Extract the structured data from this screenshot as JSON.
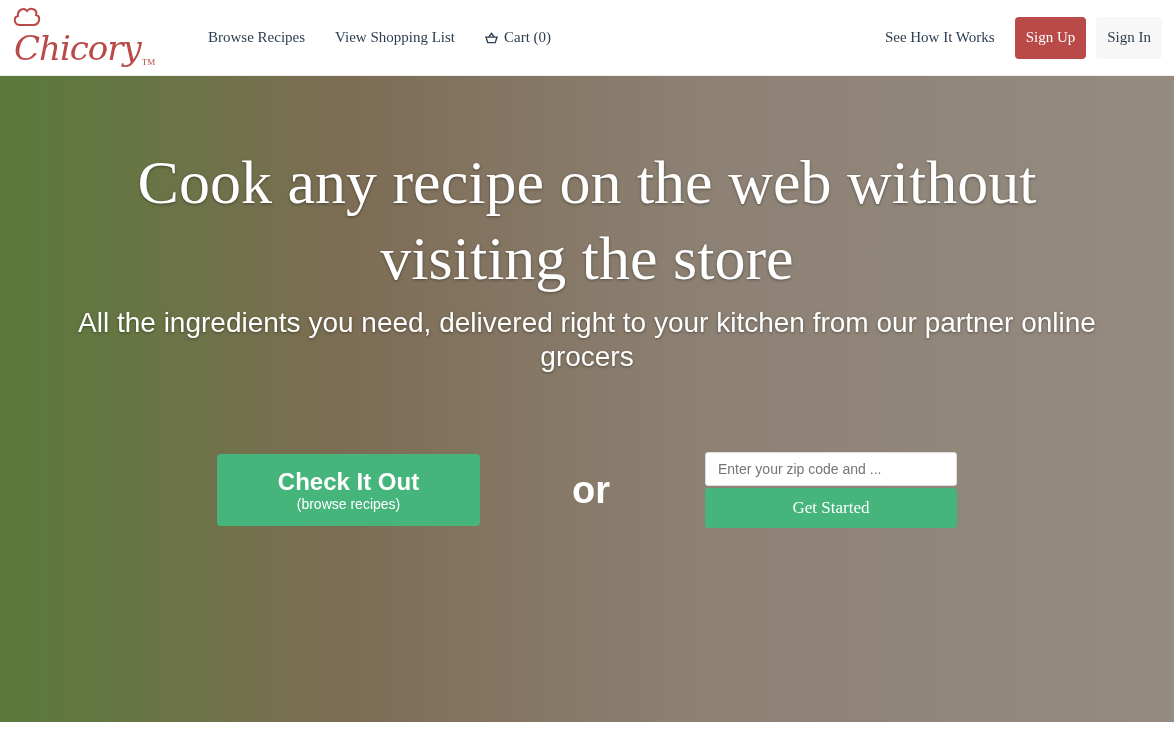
{
  "header": {
    "logo": {
      "name": "Chicory",
      "trademark": "TM"
    },
    "nav": [
      {
        "label": "Browse Recipes",
        "kind": "link"
      },
      {
        "label": "View Shopping List",
        "kind": "link"
      },
      {
        "label": "Cart (0)",
        "kind": "cart"
      }
    ],
    "right": [
      {
        "label": "See How It Works",
        "kind": "link"
      },
      {
        "label": "Sign Up",
        "kind": "primary"
      },
      {
        "label": "Sign In",
        "kind": "secondary"
      }
    ]
  },
  "hero": {
    "headline": "Cook any recipe on the web without visiting the store",
    "subheadline": "All the ingredients you need, delivered right to your kitchen from our partner online grocers",
    "cta": {
      "label": "Check It Out",
      "sublabel": "(browse recipes)"
    },
    "separator": "or",
    "zip": {
      "placeholder": "Enter your zip code and ...",
      "button": "Get Started"
    }
  }
}
